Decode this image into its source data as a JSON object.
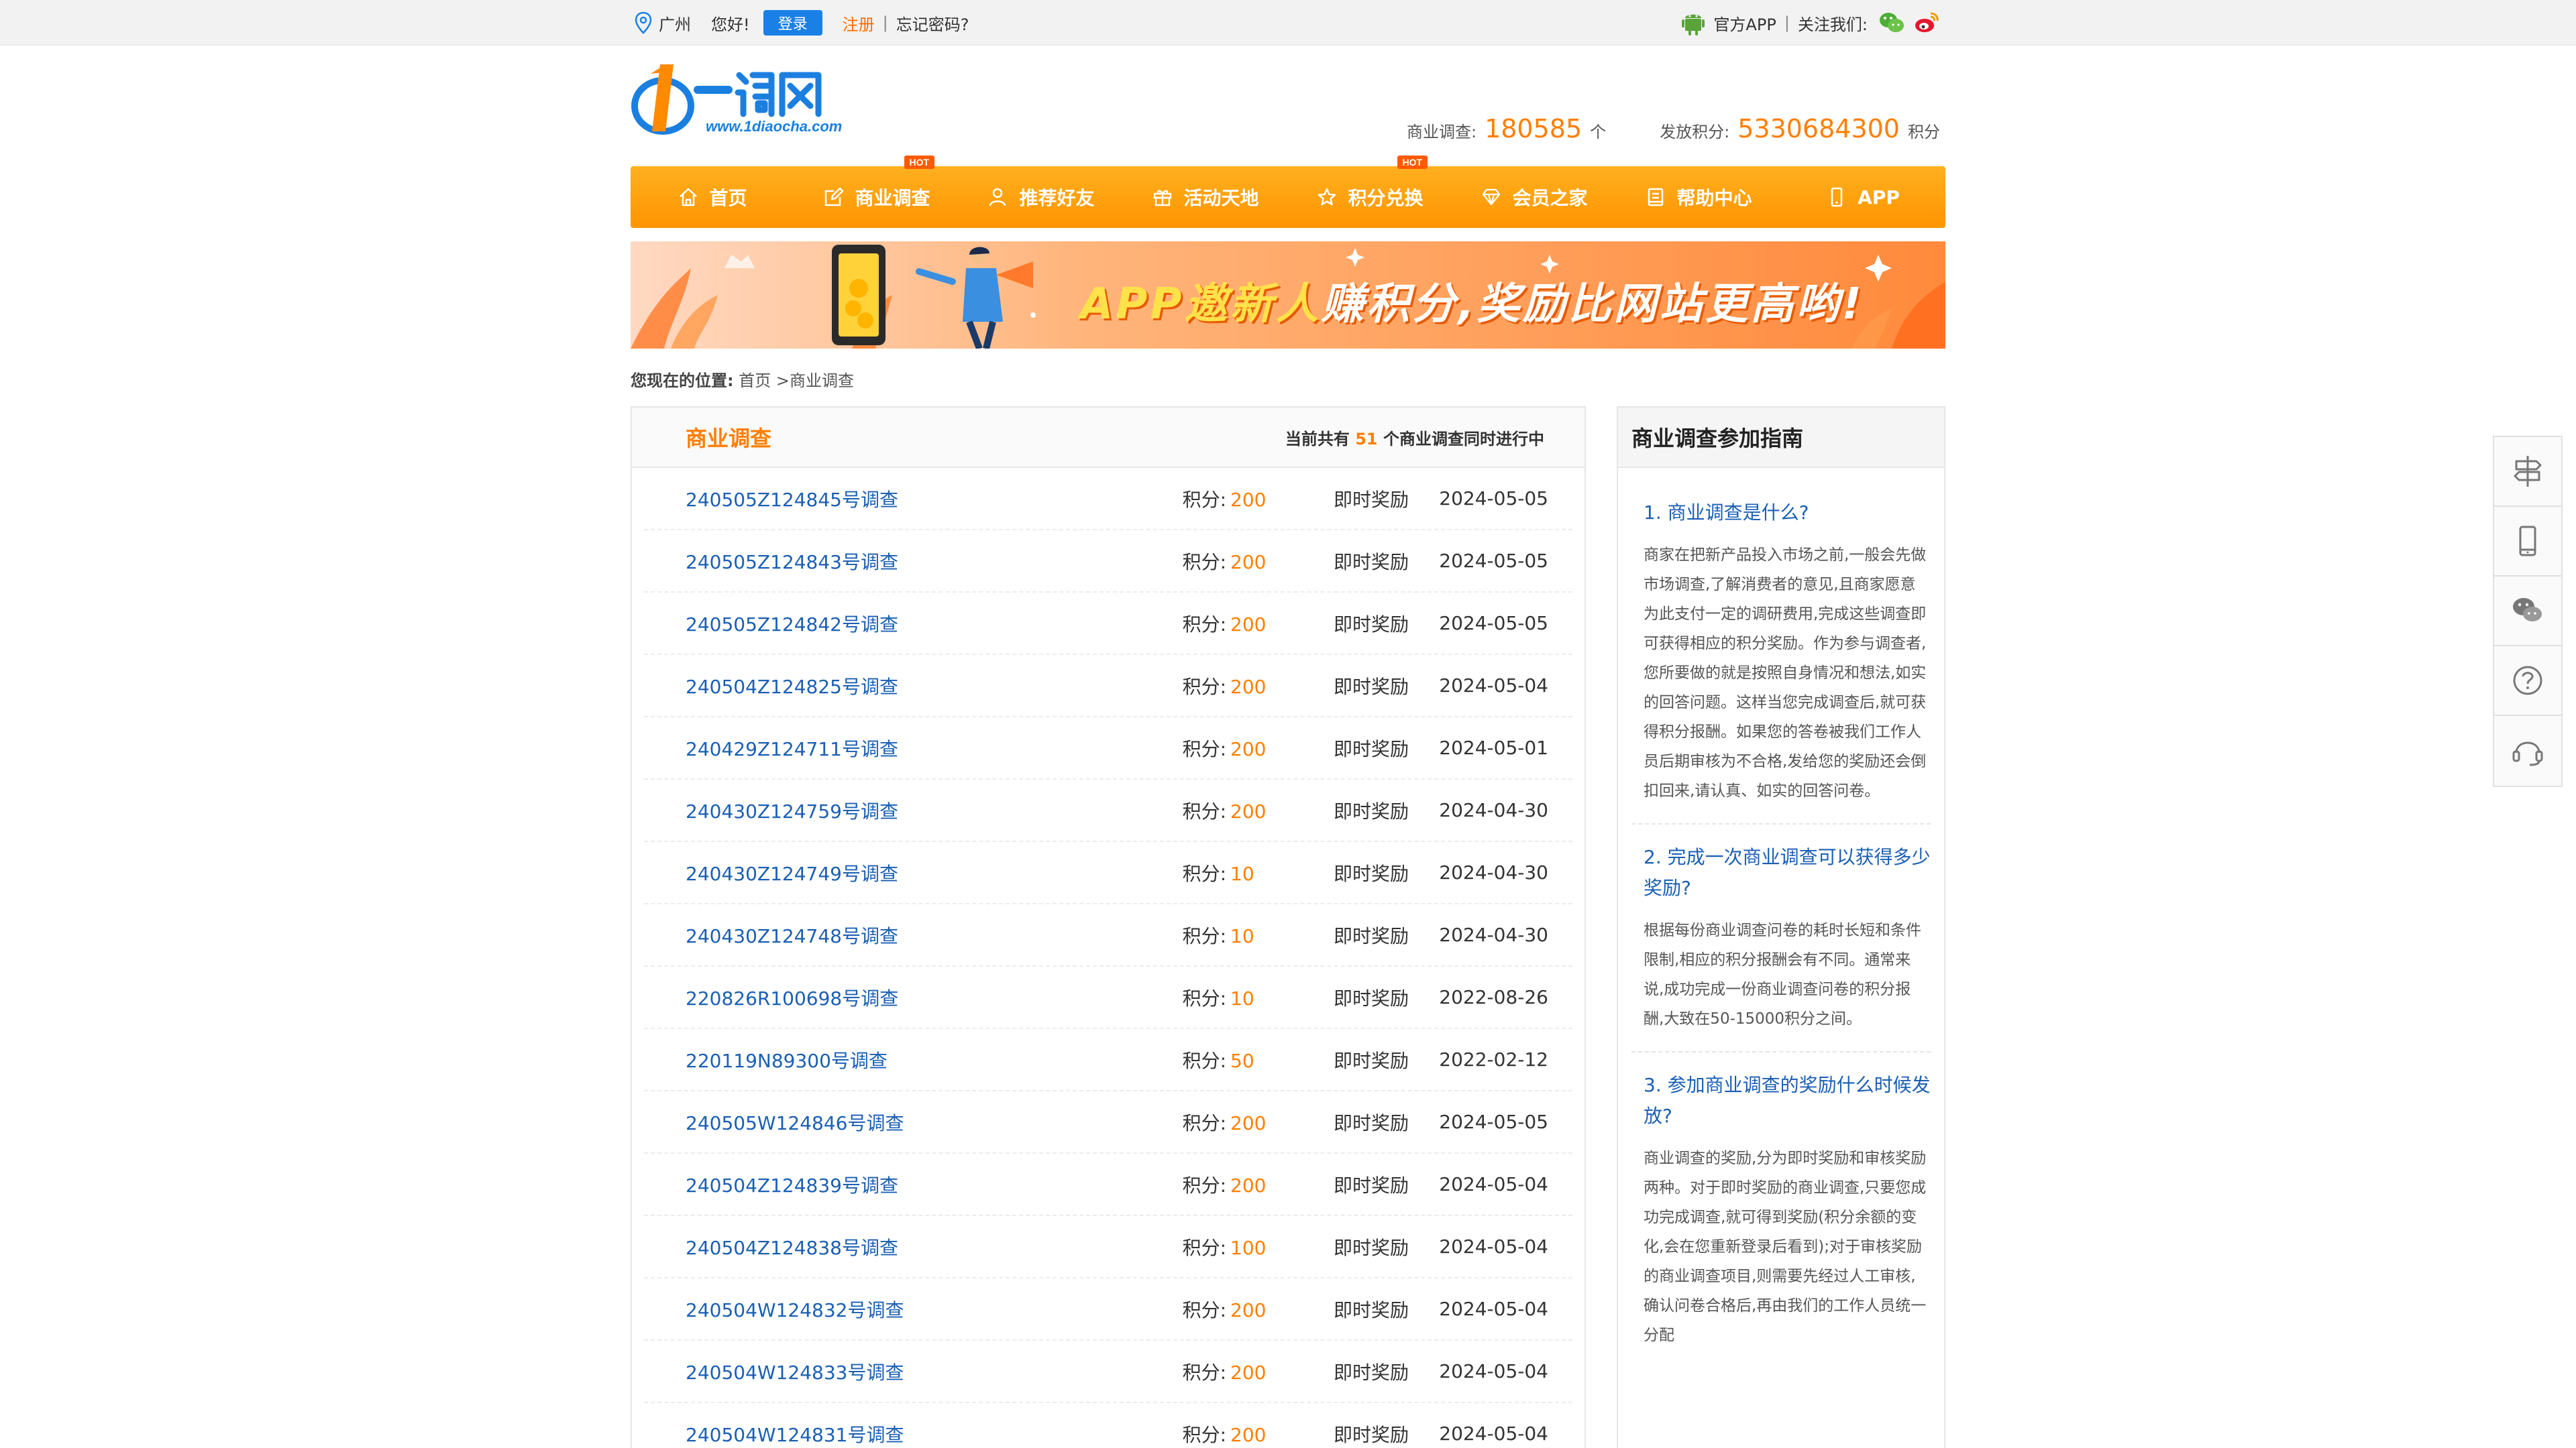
{
  "topbar": {
    "city": "广州",
    "hello": "您好!",
    "login": "登录",
    "register": "注册",
    "sep": "|",
    "forgot": "忘记密码?",
    "app": "官方APP",
    "follow": "关注我们:"
  },
  "header": {
    "stat1_label": "商业调查:",
    "stat1_value": "180585",
    "stat1_unit": "个",
    "stat2_label": "发放积分:",
    "stat2_value": "5330684300",
    "stat2_unit": "积分"
  },
  "nav": {
    "items": [
      {
        "label": "首页",
        "icon": "home-icon"
      },
      {
        "label": "商业调查",
        "icon": "edit-icon",
        "badge": "HOT"
      },
      {
        "label": "推荐好友",
        "icon": "user-icon"
      },
      {
        "label": "活动天地",
        "icon": "gift-icon"
      },
      {
        "label": "积分兑换",
        "icon": "star-icon",
        "badge": "HOT"
      },
      {
        "label": "会员之家",
        "icon": "diamond-icon"
      },
      {
        "label": "帮助中心",
        "icon": "book-icon"
      },
      {
        "label": "APP",
        "icon": "phone-icon"
      }
    ]
  },
  "banner": {
    "text_a": "APP邀新人",
    "text_b": "赚积分,奖励比网站更高哟!"
  },
  "breadcrumb": {
    "label": "您现在的位置:",
    "path": "首页 >商业调查"
  },
  "main": {
    "title": "商业调查",
    "count_prefix": "当前共有",
    "count": "51",
    "count_suffix": "个商业调查同时进行中",
    "points_label": "积分:",
    "rows": [
      {
        "name": "240505Z124845号调查",
        "points": "200",
        "reward": "即时奖励",
        "date": "2024-05-05"
      },
      {
        "name": "240505Z124843号调查",
        "points": "200",
        "reward": "即时奖励",
        "date": "2024-05-05"
      },
      {
        "name": "240505Z124842号调查",
        "points": "200",
        "reward": "即时奖励",
        "date": "2024-05-05"
      },
      {
        "name": "240504Z124825号调查",
        "points": "200",
        "reward": "即时奖励",
        "date": "2024-05-04"
      },
      {
        "name": "240429Z124711号调查",
        "points": "200",
        "reward": "即时奖励",
        "date": "2024-05-01"
      },
      {
        "name": "240430Z124759号调查",
        "points": "200",
        "reward": "即时奖励",
        "date": "2024-04-30"
      },
      {
        "name": "240430Z124749号调查",
        "points": "10",
        "reward": "即时奖励",
        "date": "2024-04-30"
      },
      {
        "name": "240430Z124748号调查",
        "points": "10",
        "reward": "即时奖励",
        "date": "2024-04-30"
      },
      {
        "name": "220826R100698号调查",
        "points": "10",
        "reward": "即时奖励",
        "date": "2022-08-26"
      },
      {
        "name": "220119N89300号调查",
        "points": "50",
        "reward": "即时奖励",
        "date": "2022-02-12"
      },
      {
        "name": "240505W124846号调查",
        "points": "200",
        "reward": "即时奖励",
        "date": "2024-05-05"
      },
      {
        "name": "240504Z124839号调查",
        "points": "200",
        "reward": "即时奖励",
        "date": "2024-05-04"
      },
      {
        "name": "240504Z124838号调查",
        "points": "100",
        "reward": "即时奖励",
        "date": "2024-05-04"
      },
      {
        "name": "240504W124832号调查",
        "points": "200",
        "reward": "即时奖励",
        "date": "2024-05-04"
      },
      {
        "name": "240504W124833号调查",
        "points": "200",
        "reward": "即时奖励",
        "date": "2024-05-04"
      },
      {
        "name": "240504W124831号调查",
        "points": "200",
        "reward": "即时奖励",
        "date": "2024-05-04"
      }
    ]
  },
  "guide": {
    "title": "商业调查参加指南",
    "sections": [
      {
        "q": "1. 商业调查是什么?",
        "a": "商家在把新产品投入市场之前,一般会先做市场调查,了解消费者的意见,且商家愿意为此支付一定的调研费用,完成这些调查即可获得相应的积分奖励。作为参与调查者,您所要做的就是按照自身情况和想法,如实的回答问题。这样当您完成调查后,就可获得积分报酬。如果您的答卷被我们工作人员后期审核为不合格,发给您的奖励还会倒扣回来,请认真、如实的回答问卷。"
      },
      {
        "q": "2. 完成一次商业调查可以获得多少奖励?",
        "a": "根据每份商业调查问卷的耗时长短和条件限制,相应的积分报酬会有不同。通常来说,成功完成一份商业调查问卷的积分报酬,大致在50-15000积分之间。"
      },
      {
        "q": "3. 参加商业调查的奖励什么时候发放?",
        "a": "商业调查的奖励,分为即时奖励和审核奖励两种。对于即时奖励的商业调查,只要您成功完成调查,就可得到奖励(积分余额的变化,会在您重新登录后看到);对于审核奖励的商业调查项目,则需要先经过人工审核,确认问卷合格后,再由我们的工作人员统一分配"
      }
    ]
  },
  "colors": {
    "accent": "#ff7f00",
    "link": "#1a5fb4",
    "login_btn": "#1b80e6"
  }
}
